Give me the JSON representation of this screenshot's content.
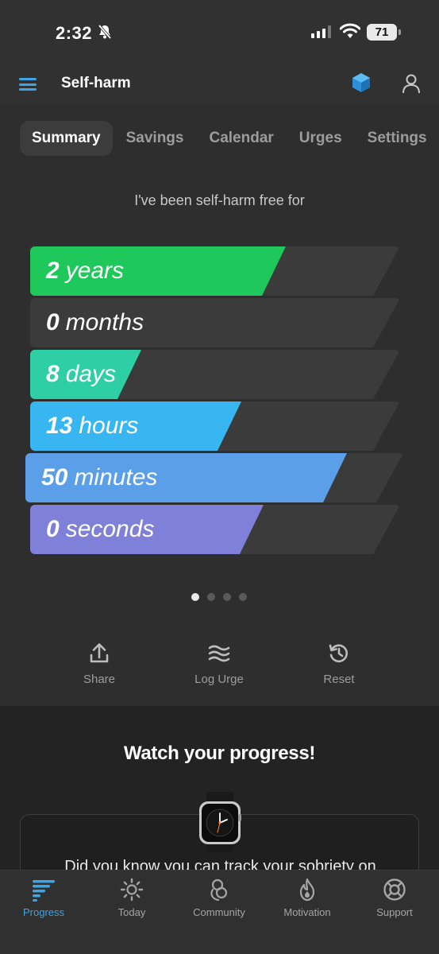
{
  "status_bar": {
    "time": "2:32",
    "battery": "71"
  },
  "header": {
    "title": "Self-harm",
    "menu_icon": "hamburger-icon",
    "premium_icon": "hexagon-icon",
    "profile_icon": "user-icon"
  },
  "tabs": [
    {
      "label": "Summary",
      "active": true
    },
    {
      "label": "Savings",
      "active": false
    },
    {
      "label": "Calendar",
      "active": false
    },
    {
      "label": "Urges",
      "active": false
    },
    {
      "label": "Settings",
      "active": false
    }
  ],
  "summary": {
    "intro": "I've been self-harm free for",
    "counters": [
      {
        "value": "2",
        "unit": "years",
        "fill_fraction": 0.69,
        "color": "#1fc85a"
      },
      {
        "value": "0",
        "unit": "months",
        "fill_fraction": 0.0,
        "color": "#3b3b3b"
      },
      {
        "value": "8",
        "unit": "days",
        "fill_fraction": 0.3,
        "color": "#2fcfa5"
      },
      {
        "value": "13",
        "unit": "hours",
        "fill_fraction": 0.57,
        "color": "#37b6f2"
      },
      {
        "value": "50",
        "unit": "minutes",
        "fill_fraction": 0.85,
        "color": "#5a9fe8"
      },
      {
        "value": "0",
        "unit": "seconds",
        "fill_fraction": 0.63,
        "color": "#7f80d8"
      }
    ],
    "page_indicator": {
      "count": 4,
      "active": 0
    }
  },
  "actions": [
    {
      "label": "Share",
      "icon": "share-icon"
    },
    {
      "label": "Log Urge",
      "icon": "waves-icon"
    },
    {
      "label": "Reset",
      "icon": "history-icon"
    }
  ],
  "promo": {
    "title": "Watch your progress!",
    "text": "Did you know you can track your sobriety on",
    "image": "smartwatch"
  },
  "bottom_nav": [
    {
      "label": "Progress",
      "icon": "progress-icon",
      "active": true
    },
    {
      "label": "Today",
      "icon": "sun-icon",
      "active": false
    },
    {
      "label": "Community",
      "icon": "community-icon",
      "active": false
    },
    {
      "label": "Motivation",
      "icon": "flame-icon",
      "active": false
    },
    {
      "label": "Support",
      "icon": "lifebuoy-icon",
      "active": false
    }
  ],
  "colors": {
    "accent": "#3aa6e6",
    "panel": "#2e2e2e",
    "background": "#1e1e1e"
  }
}
